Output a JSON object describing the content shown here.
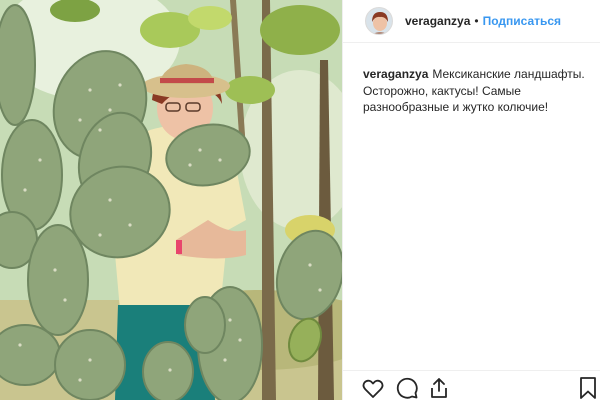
{
  "post": {
    "username": "veraganzya",
    "separator": "•",
    "follow_label": "Подписаться",
    "caption_user": "veraganzya",
    "caption_text": "Мексиканские ландшафты. Осторожно, кактусы! Самые разнообразные и жутко колючие!"
  },
  "icons": {
    "like": "heart-icon",
    "comment": "comment-icon",
    "share": "share-icon",
    "save": "bookmark-icon"
  },
  "colors": {
    "follow": "#3897f0",
    "text": "#262626",
    "border": "#efefef"
  }
}
